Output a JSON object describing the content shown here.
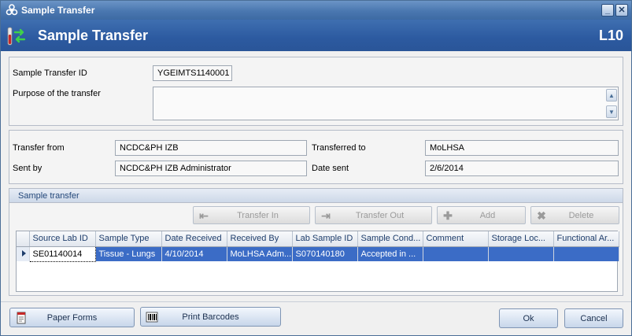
{
  "window": {
    "title": "Sample Transfer",
    "minimize_glyph": "_",
    "close_glyph": "✕"
  },
  "header": {
    "title": "Sample Transfer",
    "code": "L10"
  },
  "transfer": {
    "id_label": "Sample Transfer ID",
    "id_value": "YGEIMTS1140001",
    "purpose_label": "Purpose of the transfer",
    "purpose_value": ""
  },
  "parties": {
    "from_label": "Transfer from",
    "from_value": "NCDC&PH IZB",
    "to_label": "Transferred to",
    "to_value": "MoLHSA",
    "sent_by_label": "Sent by",
    "sent_by_value": "NCDC&PH IZB Administrator",
    "date_sent_label": "Date sent",
    "date_sent_value": "2/6/2014"
  },
  "sample_section": {
    "title": "Sample transfer",
    "buttons": {
      "transfer_in": "Transfer In",
      "transfer_out": "Transfer Out",
      "add": "Add",
      "delete": "Delete"
    },
    "columns": [
      "Source Lab ID",
      "Sample Type",
      "Date Received",
      "Received By",
      "Lab Sample ID",
      "Sample Cond...",
      "Comment",
      "Storage Loc...",
      "Functional Ar..."
    ],
    "rows": [
      [
        "SE01140014",
        "Tissue - Lungs",
        "4/10/2014",
        "MoLHSA Adm...",
        "S070140180",
        "Accepted in ...",
        "",
        "",
        ""
      ]
    ]
  },
  "footer": {
    "paper_forms": "Paper Forms",
    "print_barcodes": "Print Barcodes",
    "ok": "Ok",
    "cancel": "Cancel"
  },
  "icons": {
    "app": "biohazard-icon",
    "header": "sample-transfer-icon",
    "transfer_in": "arrow-in-icon",
    "transfer_out": "arrow-out-icon",
    "add": "plus-icon",
    "delete": "delete-x-icon",
    "paper_forms": "document-icon",
    "print_barcodes": "barcode-icon"
  },
  "colors": {
    "header_bg": "#2c5aa0",
    "titlebar_bg": "#4a77b0",
    "selection": "#3b6cc6",
    "section_title": "#24487a"
  }
}
